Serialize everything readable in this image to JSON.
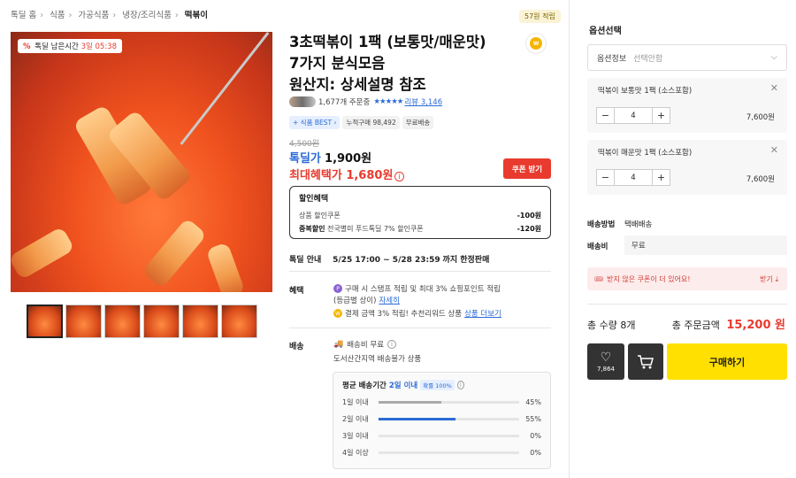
{
  "breadcrumb": [
    "톡딜 홈",
    "식품",
    "가공식품",
    "냉장/조리식품",
    "떡볶이"
  ],
  "main_image": {
    "timer_pct_icon": "%",
    "timer_label": "톡딜 남은시간",
    "timer_days": "3일",
    "timer_time": "05:38"
  },
  "thumbnails_count": 6,
  "reward": {
    "badge": "57원 적립",
    "coin_text": "W"
  },
  "product": {
    "title_lines": [
      "3초떡볶이 1팩 (보통맛/매운맛)",
      "7가지 분식모음",
      "원산지: 상세설명 참조"
    ],
    "order_count": "1,677개 주문중",
    "stars": "★★★★★",
    "review_link": "리뷰 3,146",
    "tags": [
      "식품 BEST",
      "누적구매 98,492",
      "무료배송"
    ],
    "original_price": "4,500원",
    "deal_price_label": "톡딜가",
    "deal_price_value": "1,900원",
    "max_benefit_price": "최대혜택가 1,680원",
    "coupon_button": "쿠폰 받기"
  },
  "discount": {
    "title": "할인혜택",
    "rows": [
      {
        "name": "상품 할인쿠폰",
        "bold": "",
        "amount": "-100원"
      },
      {
        "name": "전국별미 푸드톡딜 7% 할인쿠폰",
        "bold": "중복할인",
        "amount": "-120원"
      }
    ]
  },
  "deal_info": {
    "label": "톡딜 안내",
    "range": "5/25 17:00 ~ 5/28 23:59",
    "suffix": "까지 한정판매"
  },
  "benefits": {
    "label": "혜택",
    "row1": "구매 시 스탬프 적립 및 최대 3% 쇼핑포인트 적립",
    "row1b": "(등급별 상이)",
    "row1_link": "자세히",
    "row2": "결제 금액 3% 적립! 추천리워드 상품",
    "row2_link": "상품 더보기"
  },
  "shipping": {
    "label": "배송",
    "fee": "배송비 무료",
    "note": "도서산간지역 배송불가 상품",
    "delivery_title": "평균 배송기간",
    "delivery_highlight": "2일 이내",
    "delivery_pill": "확률 100%",
    "rows": [
      {
        "label": "1일 이내",
        "pct": "45%",
        "value": 45,
        "highlight": false
      },
      {
        "label": "2일 이내",
        "pct": "55%",
        "value": 55,
        "highlight": true
      },
      {
        "label": "3일 이내",
        "pct": "0%",
        "value": 0,
        "highlight": false
      },
      {
        "label": "4일 이상",
        "pct": "0%",
        "value": 0,
        "highlight": false
      }
    ]
  },
  "panel": {
    "title": "옵션선택",
    "select_label": "옵션정보",
    "select_placeholder": "선택안함",
    "options": [
      {
        "name": "떡볶이 보통맛 1팩 (소스포함)",
        "qty": "4",
        "price": "7,600원"
      },
      {
        "name": "떡볶이 매운맛 1팩 (소스포함)",
        "qty": "4",
        "price": "7,600원"
      }
    ],
    "ship_method_label": "배송방법",
    "ship_method_value": "택배배송",
    "ship_fee_label": "배송비",
    "ship_fee_value": "무료",
    "coupon_banner": "받지 않은 쿠폰이 더 있어요!",
    "coupon_get": "받기",
    "total_qty": "총 수량 8개",
    "total_label": "총 주문금액",
    "total_value": "15,200 원",
    "like_count": "7,864",
    "buy_label": "구매하기"
  },
  "colors": {
    "accent_red": "#e83b2e",
    "accent_blue": "#2b6bd6",
    "buy_yellow": "#ffe000"
  }
}
